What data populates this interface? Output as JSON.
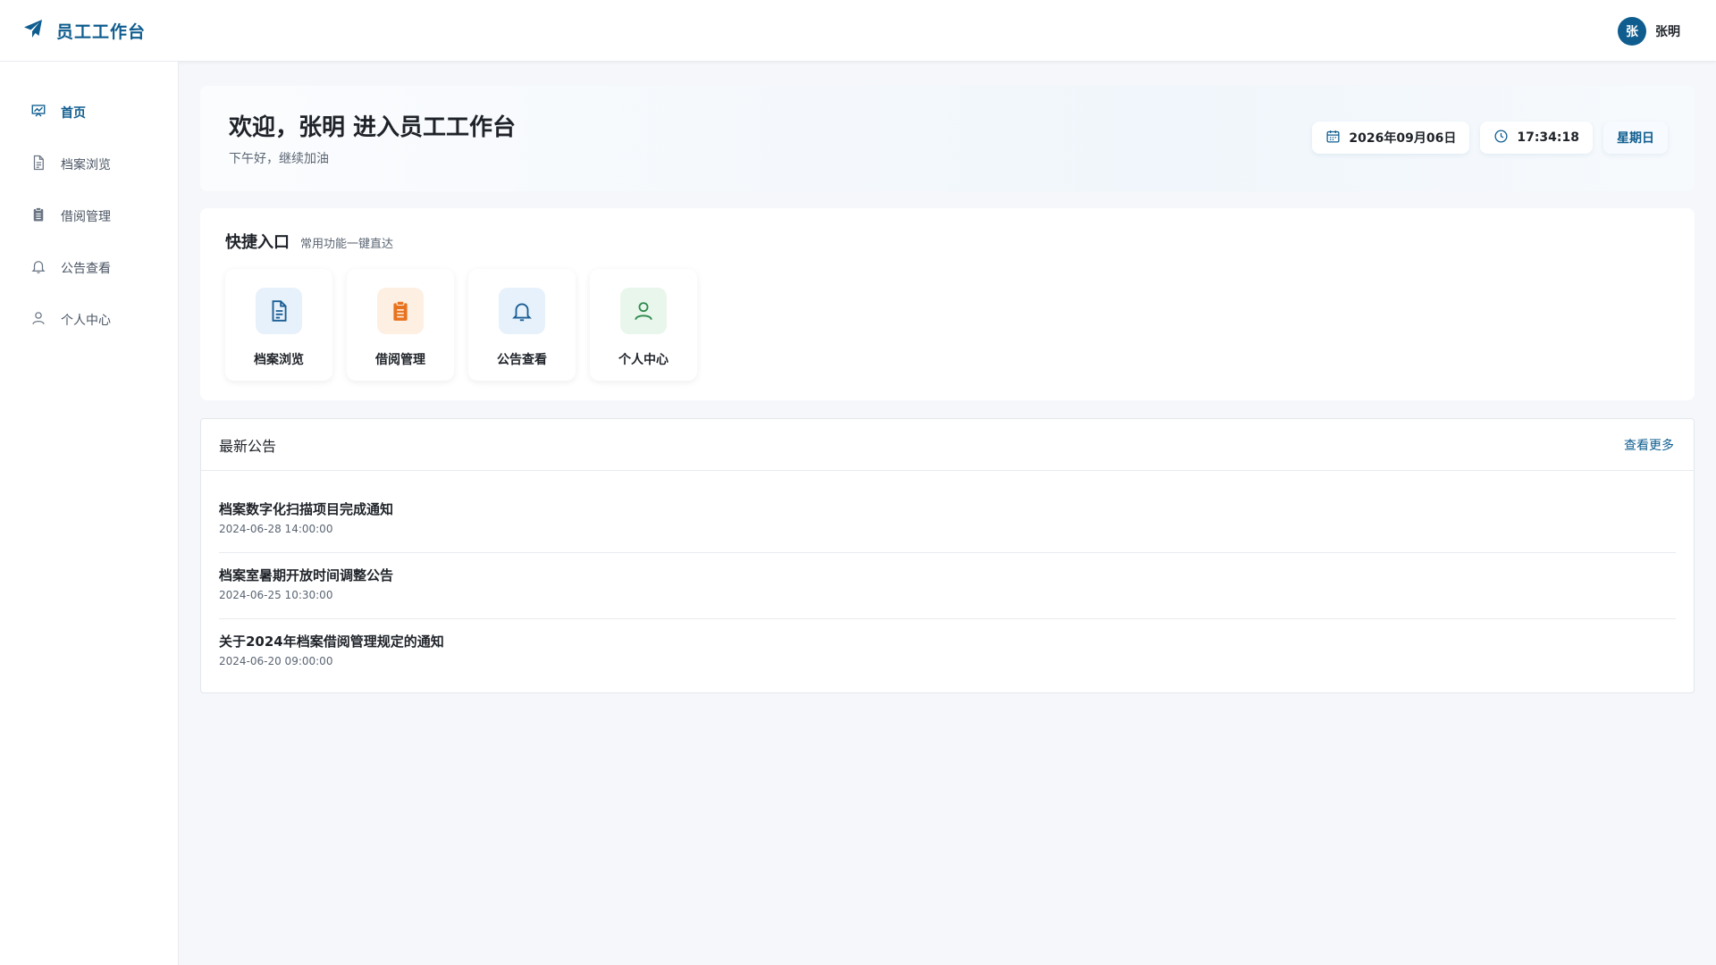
{
  "app": {
    "title": "员工工作台"
  },
  "user": {
    "avatar_text": "张",
    "name": "张明"
  },
  "sidebar": {
    "items": [
      {
        "label": "首页",
        "icon": "dashboard-icon",
        "active": true
      },
      {
        "label": "档案浏览",
        "icon": "document-icon",
        "active": false
      },
      {
        "label": "借阅管理",
        "icon": "clipboard-icon",
        "active": false
      },
      {
        "label": "公告查看",
        "icon": "bell-icon",
        "active": false
      },
      {
        "label": "个人中心",
        "icon": "user-icon",
        "active": false
      }
    ]
  },
  "welcome": {
    "title": "欢迎，张明 进入员工工作台",
    "subtitle": "下午好，继续加油",
    "date": "2026年09月06日",
    "time": "17:34:18",
    "weekday": "星期日"
  },
  "quick": {
    "title": "快捷入口",
    "subtitle": "常用功能一键直达",
    "tiles": [
      {
        "label": "档案浏览",
        "icon": "document-icon",
        "bg": "#e6f1fb",
        "color": "#1a5d93"
      },
      {
        "label": "借阅管理",
        "icon": "clipboard-icon",
        "bg": "#fdefe2",
        "color": "#e8731f"
      },
      {
        "label": "公告查看",
        "icon": "bell-icon",
        "bg": "#e6f1fb",
        "color": "#1a5d93"
      },
      {
        "label": "个人中心",
        "icon": "user-icon",
        "bg": "#e8f6ec",
        "color": "#2e8a4c"
      }
    ]
  },
  "notices": {
    "title": "最新公告",
    "more": "查看更多",
    "items": [
      {
        "title": "档案数字化扫描项目完成通知",
        "time": "2024-06-28 14:00:00"
      },
      {
        "title": "档案室暑期开放时间调整公告",
        "time": "2024-06-25 10:30:00"
      },
      {
        "title": "关于2024年档案借阅管理规定的通知",
        "time": "2024-06-20 09:00:00"
      }
    ]
  },
  "colors": {
    "brand": "#0f5d8f",
    "background": "#f5f7fa"
  }
}
